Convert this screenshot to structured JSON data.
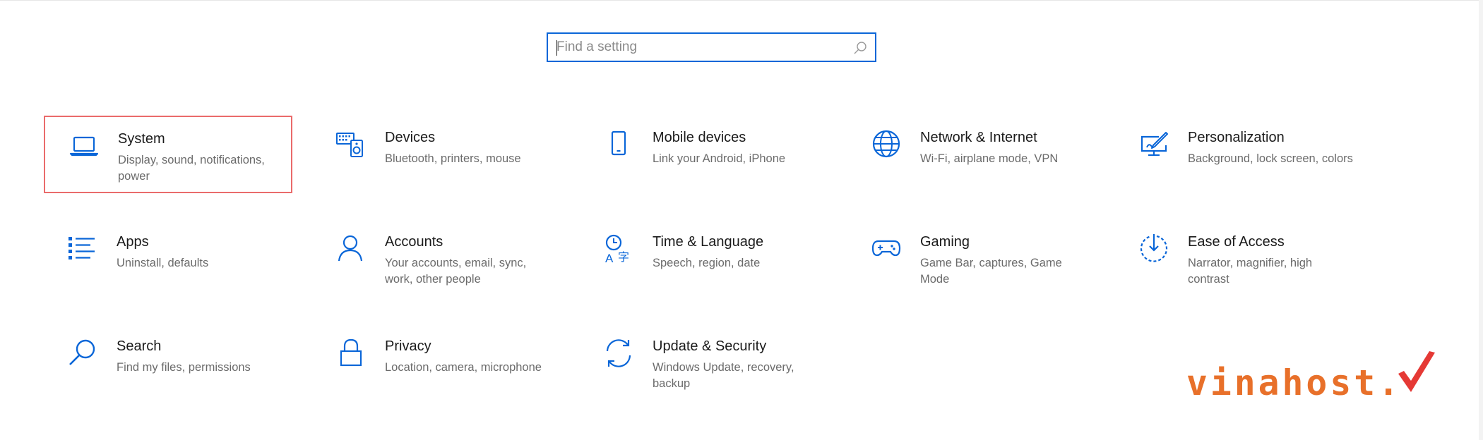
{
  "search": {
    "placeholder": "Find a setting",
    "value": ""
  },
  "accent_color": "#0a66d8",
  "selection_color": "#ea6b6b",
  "tiles": [
    {
      "title": "System",
      "description": "Display, sound, notifications, power",
      "icon": "laptop-icon",
      "selected": true
    },
    {
      "title": "Devices",
      "description": "Bluetooth, printers, mouse",
      "icon": "devices-icon"
    },
    {
      "title": "Mobile devices",
      "description": "Link your Android, iPhone",
      "icon": "phone-icon"
    },
    {
      "title": "Network & Internet",
      "description": "Wi-Fi, airplane mode, VPN",
      "icon": "globe-icon"
    },
    {
      "title": "Personalization",
      "description": "Background, lock screen, colors",
      "icon": "paint-icon"
    },
    {
      "title": "Apps",
      "description": "Uninstall, defaults",
      "icon": "apps-list-icon"
    },
    {
      "title": "Accounts",
      "description": "Your accounts, email, sync, work, other people",
      "icon": "person-icon"
    },
    {
      "title": "Time & Language",
      "description": "Speech, region, date",
      "icon": "time-language-icon"
    },
    {
      "title": "Gaming",
      "description": "Game Bar, captures, Game Mode",
      "icon": "gamepad-icon"
    },
    {
      "title": "Ease of Access",
      "description": "Narrator, magnifier, high contrast",
      "icon": "ease-of-access-icon"
    },
    {
      "title": "Search",
      "description": "Find my files, permissions",
      "icon": "search-icon"
    },
    {
      "title": "Privacy",
      "description": "Location, camera, microphone",
      "icon": "lock-icon"
    },
    {
      "title": "Update & Security",
      "description": "Windows Update, recovery, backup",
      "icon": "sync-icon"
    }
  ],
  "watermark": {
    "text": "vinahost.",
    "color": "#e8702a",
    "check_color": "#e53935"
  }
}
